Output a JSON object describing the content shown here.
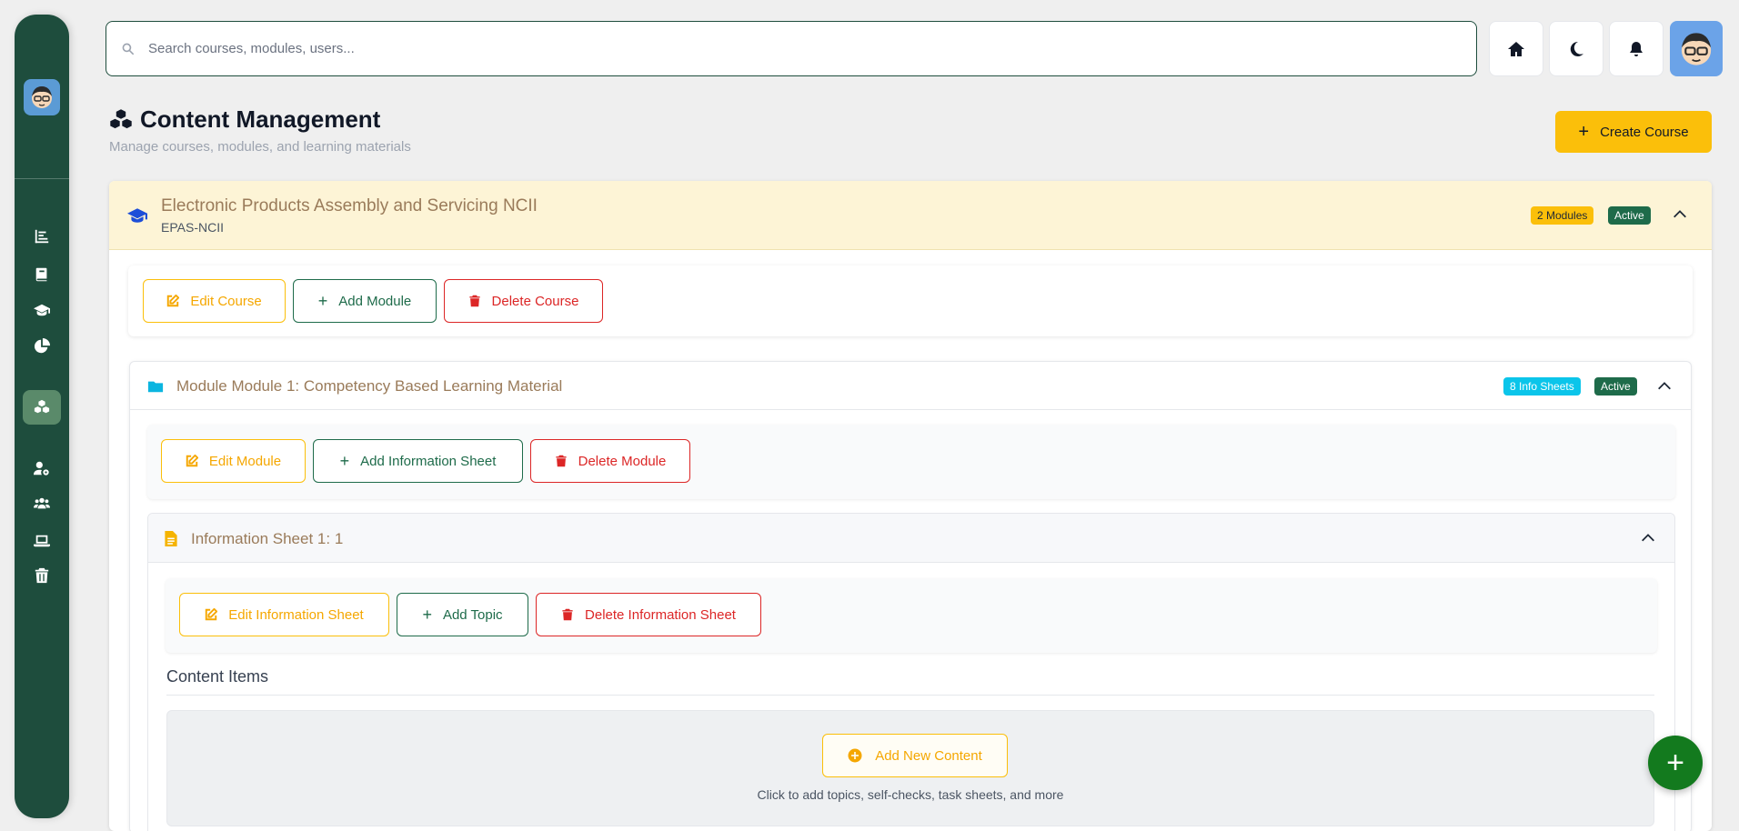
{
  "search": {
    "placeholder": "Search courses, modules, users..."
  },
  "header": {
    "title": "Content Management",
    "subtitle": "Manage courses, modules, and learning materials",
    "create_label": "Create Course",
    "create_plus": "+"
  },
  "course": {
    "title": "Electronic Products Assembly and Servicing NCII",
    "code": "EPAS-NCII",
    "modules_badge": "2 Modules",
    "status_badge": "Active",
    "actions": {
      "edit": "Edit Course",
      "add": "Add Module",
      "delete": "Delete Course"
    }
  },
  "module": {
    "title": "Module Module 1: Competency Based Learning Material",
    "sheets_badge": "8 Info Sheets",
    "status_badge": "Active",
    "actions": {
      "edit": "Edit Module",
      "add": "Add Information Sheet",
      "delete": "Delete Module"
    }
  },
  "sheet": {
    "title": "Information Sheet 1: 1",
    "actions": {
      "edit": "Edit Information Sheet",
      "add": "Add Topic",
      "delete": "Delete Information Sheet"
    },
    "content_label": "Content Items",
    "add_content": "Add New Content",
    "hint": "Click to add topics, self-checks, task sheets, and more"
  },
  "fab": {
    "label": "+"
  },
  "plus_glyph": "+",
  "colors": {
    "sidebar": "#1e4d3d",
    "accent_yellow": "#fbbf0a",
    "accent_green": "#1e6b4a",
    "danger": "#dc2626",
    "info_cyan": "#0bc5ea",
    "fab_green": "#137a1e"
  },
  "icons": {
    "sidebar": [
      "bar-chart-icon",
      "book-icon",
      "graduation-cap-icon",
      "pie-chart-icon",
      "cubes-icon",
      "user-gear-icon",
      "users-icon",
      "laptop-icon",
      "trash-icon"
    ],
    "top": [
      "home-icon",
      "moon-icon",
      "bell-icon"
    ]
  }
}
